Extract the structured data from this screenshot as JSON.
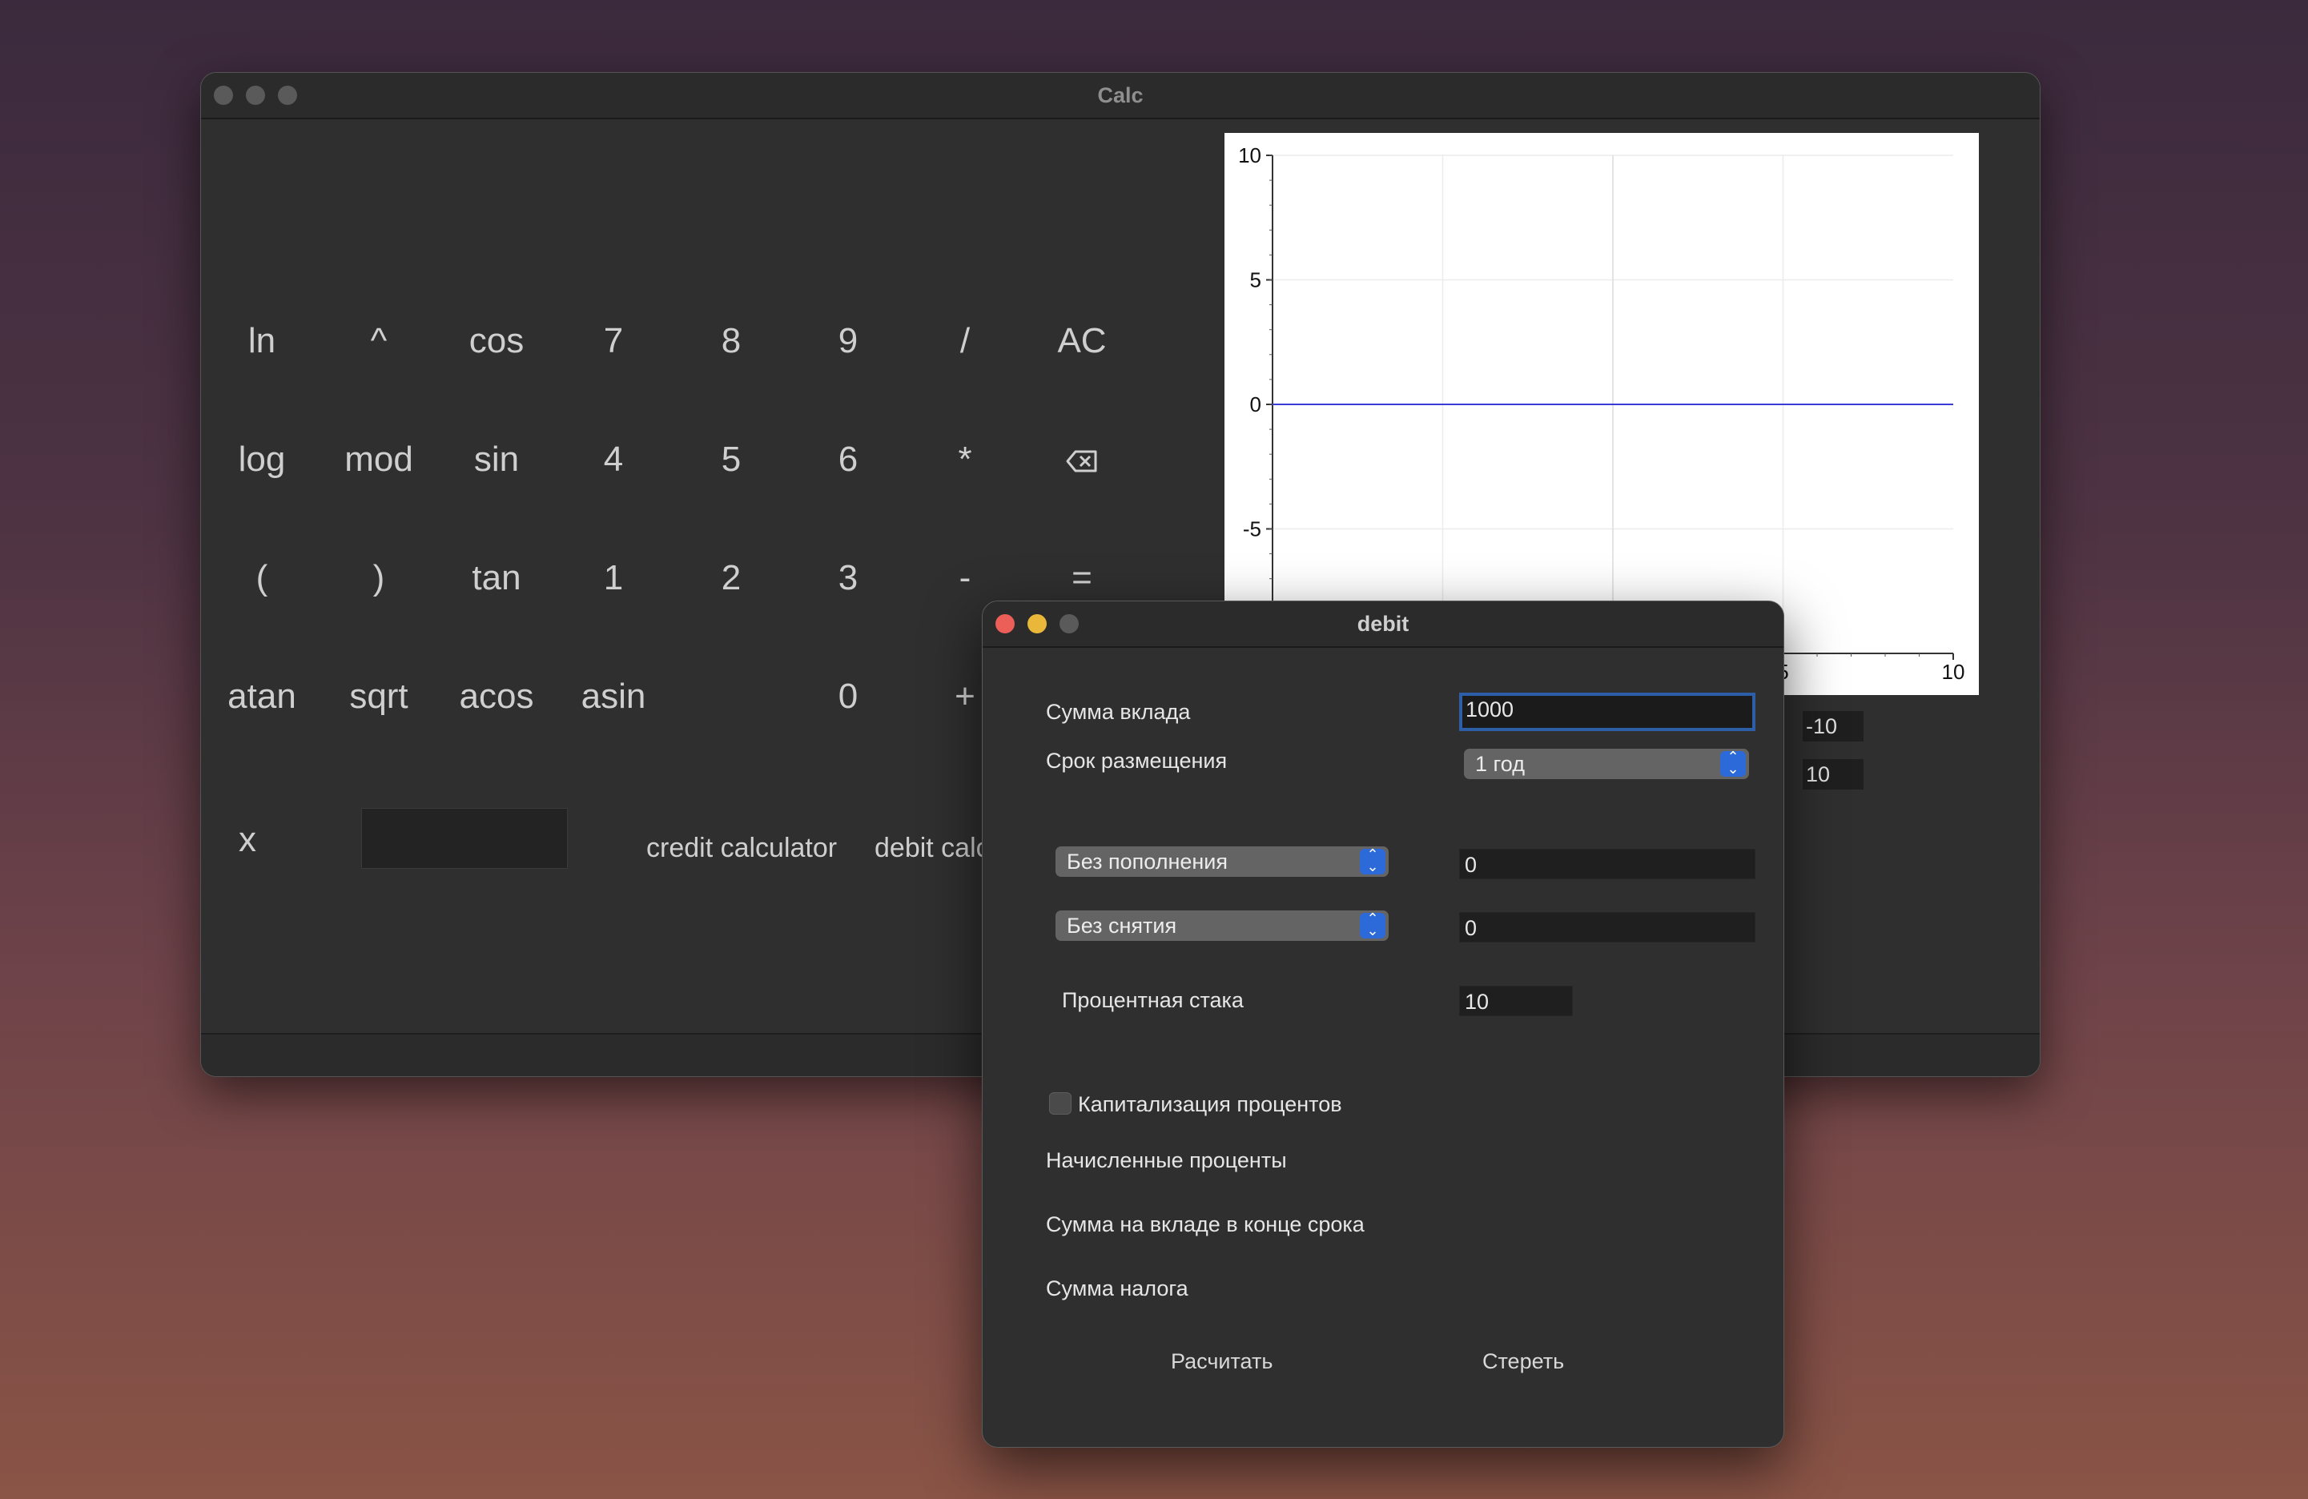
{
  "calc": {
    "title": "Calc",
    "buttons": {
      "ln": "ln",
      "pow": "^",
      "cos": "cos",
      "n7": "7",
      "n8": "8",
      "n9": "9",
      "div": "/",
      "ac": "AC",
      "log": "log",
      "mod": "mod",
      "sin": "sin",
      "n4": "4",
      "n5": "5",
      "n6": "6",
      "mul": "*",
      "backspace": "⌫",
      "lpar": "(",
      "rpar": ")",
      "tan": "tan",
      "n1": "1",
      "n2": "2",
      "n3": "3",
      "minus": "-",
      "eq": "=",
      "atan": "atan",
      "sqrt": "sqrt",
      "acos": "acos",
      "asin": "asin",
      "n0": "0",
      "plus": "+",
      "x": "x"
    },
    "credit_label": "credit calculator",
    "debit_label": "debit calc",
    "x_min": "-10",
    "x_max": "10"
  },
  "chart_data": {
    "type": "line",
    "x": [
      -10,
      10
    ],
    "series": [
      {
        "values": [
          0,
          0
        ],
        "color": "#3b3bd6"
      }
    ],
    "xlim": [
      -10,
      10
    ],
    "ylim": [
      -10,
      10
    ],
    "y_ticks": [
      "10",
      "5",
      "0",
      "-5"
    ],
    "x_ticks_visible": [
      "5",
      "10"
    ],
    "grid": true
  },
  "debit": {
    "title": "debit",
    "deposit_label": "Сумма вклада",
    "deposit_value": "1000",
    "term_label": "Срок размещения",
    "term_value": "1 год",
    "replenish_mode": "Без пополнения",
    "replenish_value": "0",
    "withdraw_mode": "Без снятия",
    "withdraw_value": "0",
    "rate_label": "Процентная стака",
    "rate_value": "10",
    "capitalization_label": "Капитализация процентов",
    "capitalization_checked": false,
    "accrued_label": "Начисленные проценты",
    "final_sum_label": "Сумма на вкладе в конце срока",
    "tax_label": "Сумма налога",
    "calculate_label": "Расчитать",
    "clear_label": "Стереть"
  }
}
